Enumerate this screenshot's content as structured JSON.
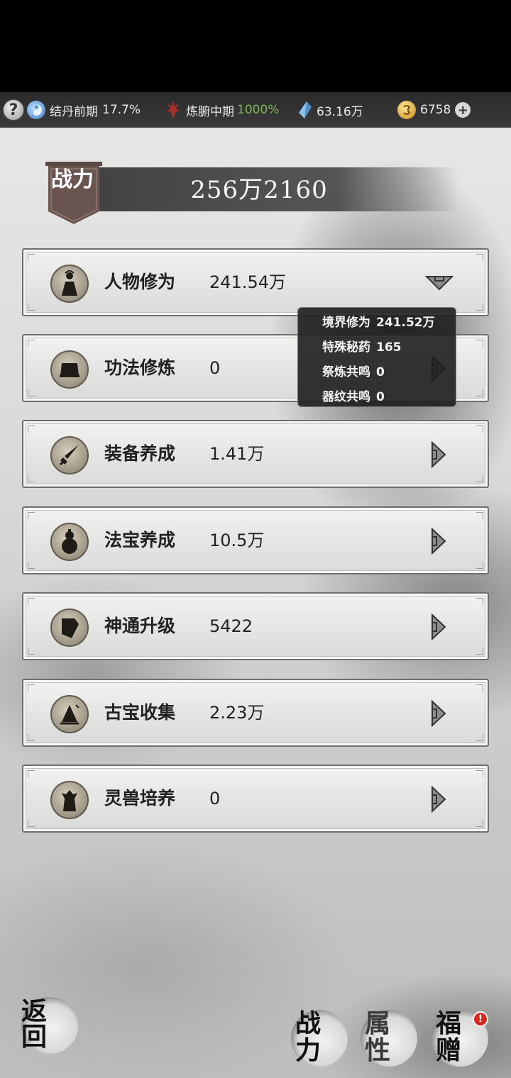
{
  "topbar": {
    "help_label": "?",
    "realm": "结丹前期",
    "realm_pct": "17.7%",
    "body_realm": "炼腑中期",
    "body_pct": "1000%",
    "spirit_stones": "63.16万",
    "gold": "6758",
    "plus_label": "+"
  },
  "power": {
    "badge": "战力",
    "value": "256万2160"
  },
  "rows": [
    {
      "label": "人物修为",
      "value": "241.54万",
      "icon": "figure-icon",
      "expanded": true
    },
    {
      "label": "功法修炼",
      "value": "0",
      "icon": "scroll-icon"
    },
    {
      "label": "装备养成",
      "value": "1.41万",
      "icon": "sword-icon"
    },
    {
      "label": "法宝养成",
      "value": "10.5万",
      "icon": "gourd-icon"
    },
    {
      "label": "神通升级",
      "value": "5422",
      "icon": "talisman-icon"
    },
    {
      "label": "古宝收集",
      "value": "2.23万",
      "icon": "bell-icon"
    },
    {
      "label": "灵兽培养",
      "value": "0",
      "icon": "beast-icon"
    }
  ],
  "tooltip": [
    {
      "label": "境界修为",
      "value": "241.52万"
    },
    {
      "label": "特殊秘药",
      "value": "165"
    },
    {
      "label": "祭炼共鸣",
      "value": "0"
    },
    {
      "label": "器纹共鸣",
      "value": "0"
    }
  ],
  "bottom": {
    "back": "返回",
    "power_tab": "战力",
    "attr_tab": "属性",
    "gift_tab": "福赠",
    "alert": "!"
  },
  "colors": {
    "accent_green": "#7fb85a",
    "alert_red": "#d42a22"
  }
}
